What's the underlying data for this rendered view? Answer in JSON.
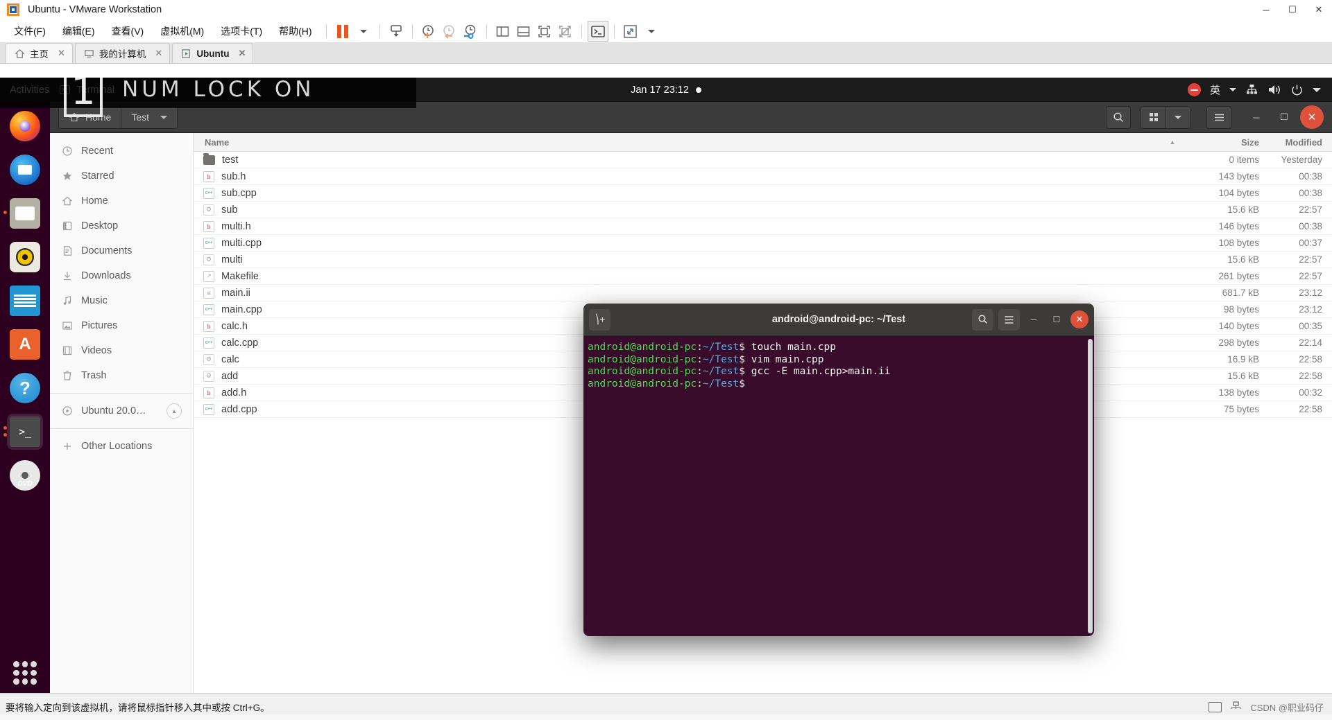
{
  "vmware": {
    "title": "Ubuntu - VMware Workstation",
    "logo_icon": "vmware-logo-icon",
    "window_controls": [
      {
        "name": "minimize-button",
        "glyph": "─"
      },
      {
        "name": "maximize-button",
        "glyph": "❐"
      },
      {
        "name": "close-button",
        "glyph": "✕"
      }
    ],
    "menus": [
      {
        "label": "文件(F)",
        "name": "menu-file"
      },
      {
        "label": "编辑(E)",
        "name": "menu-edit"
      },
      {
        "label": "查看(V)",
        "name": "menu-view"
      },
      {
        "label": "虚拟机(M)",
        "name": "menu-vm"
      },
      {
        "label": "选项卡(T)",
        "name": "menu-tabs"
      },
      {
        "label": "帮助(H)",
        "name": "menu-help"
      }
    ],
    "toolbar": [
      {
        "name": "suspend-button",
        "icon": "pause-icon"
      },
      {
        "name": "power-dropdown",
        "icon": "chevron-down-icon"
      },
      {
        "name": "send-ctrl-alt-del-button",
        "icon": "keyboard-send-icon"
      },
      {
        "name": "take-snapshot-button",
        "icon": "snapshot-add-icon"
      },
      {
        "name": "revert-snapshot-button",
        "icon": "snapshot-revert-icon"
      },
      {
        "name": "snapshot-manager-button",
        "icon": "snapshot-manage-icon"
      },
      {
        "name": "show-library-button",
        "icon": "panel-left-icon"
      },
      {
        "name": "show-thumbnail-bar-button",
        "icon": "panel-bottom-icon"
      },
      {
        "name": "show-console-view-button",
        "icon": "console-view-icon"
      },
      {
        "name": "hide-console-view-button",
        "icon": "console-view-off-icon"
      },
      {
        "name": "unity-mode-button",
        "icon": "terminal-prompt-icon"
      },
      {
        "name": "fullscreen-button",
        "icon": "expand-arrows-icon"
      },
      {
        "name": "fullscreen-dropdown",
        "icon": "chevron-down-icon"
      }
    ],
    "tabs": [
      {
        "label": "主页",
        "icon": "home-icon",
        "name": "tab-home",
        "active": false
      },
      {
        "label": "我的计算机",
        "icon": "computer-icon",
        "name": "tab-my-computer",
        "active": false
      },
      {
        "label": "Ubuntu",
        "icon": "vm-play-icon",
        "name": "tab-ubuntu",
        "active": true
      }
    ],
    "tab_close_glyph": "✕",
    "statusbar": {
      "hint": "要将输入定向到该虚拟机，请将鼠标指针移入其中或按 Ctrl+G。",
      "watermark": "CSDN @职业码仔",
      "icons": [
        "hdd-activity-icon",
        "network-activity-icon"
      ]
    }
  },
  "numlock_overlay": {
    "badge": "1",
    "text": "NUM LOCK ON"
  },
  "gnome": {
    "topbar": {
      "activities": "Activities",
      "app_name": "Terminal",
      "app_icon": "terminal-icon",
      "clock": "Jan 17  23:12",
      "notification_dot": "notification-dot-icon",
      "ime": "英",
      "indicators": [
        "do-not-disturb-icon",
        "ime-switcher",
        "network-icon",
        "volume-icon",
        "power-icon",
        "chevron-down-icon"
      ]
    },
    "dock": [
      {
        "name": "dock-firefox",
        "label": "Firefox",
        "icon": "firefox-icon",
        "running": false
      },
      {
        "name": "dock-thunderbird",
        "label": "Thunderbird",
        "icon": "thunderbird-icon",
        "running": false
      },
      {
        "name": "dock-files",
        "label": "Files",
        "icon": "files-icon",
        "running": true
      },
      {
        "name": "dock-rhythmbox",
        "label": "Rhythmbox",
        "icon": "rhythmbox-icon",
        "running": false
      },
      {
        "name": "dock-libreoffice",
        "label": "LibreOffice Writer",
        "icon": "libreoffice-writer-icon",
        "running": false
      },
      {
        "name": "dock-software",
        "label": "Ubuntu Software",
        "icon": "ubuntu-software-icon",
        "running": false
      },
      {
        "name": "dock-help",
        "label": "Help",
        "icon": "help-icon",
        "running": false
      },
      {
        "name": "dock-terminal",
        "label": "Terminal",
        "icon": "terminal-icon",
        "running": true
      },
      {
        "name": "dock-dvd",
        "label": "Ubuntu 20.0...",
        "icon": "dvd-disc-icon",
        "running": false
      }
    ],
    "show_apps": "show-applications-icon"
  },
  "files_app": {
    "breadcrumbs": [
      {
        "label": "Home",
        "icon": "home-icon",
        "name": "breadcrumb-home"
      },
      {
        "label": "Test",
        "icon": "chevron-down-icon",
        "name": "breadcrumb-test"
      }
    ],
    "header_buttons": [
      {
        "name": "search-button",
        "icon": "search-icon"
      },
      {
        "name": "grid-view-button",
        "icon": "grid-view-icon"
      },
      {
        "name": "view-options-dropdown",
        "icon": "chevron-down-icon"
      },
      {
        "name": "hamburger-menu-button",
        "icon": "hamburger-menu-icon"
      },
      {
        "name": "window-minimize-button",
        "icon": "minimize-icon"
      },
      {
        "name": "window-maximize-button",
        "icon": "maximize-icon"
      },
      {
        "name": "window-close-button",
        "icon": "close-icon"
      }
    ],
    "sidebar": [
      {
        "label": "Recent",
        "icon": "clock-icon",
        "name": "sidebar-item-recent"
      },
      {
        "label": "Starred",
        "icon": "star-icon",
        "name": "sidebar-item-starred"
      },
      {
        "label": "Home",
        "icon": "home-icon",
        "name": "sidebar-item-home"
      },
      {
        "label": "Desktop",
        "icon": "desktop-icon",
        "name": "sidebar-item-desktop"
      },
      {
        "label": "Documents",
        "icon": "documents-icon",
        "name": "sidebar-item-documents"
      },
      {
        "label": "Downloads",
        "icon": "download-icon",
        "name": "sidebar-item-downloads"
      },
      {
        "label": "Music",
        "icon": "music-note-icon",
        "name": "sidebar-item-music"
      },
      {
        "label": "Pictures",
        "icon": "picture-icon",
        "name": "sidebar-item-pictures"
      },
      {
        "label": "Videos",
        "icon": "film-icon",
        "name": "sidebar-item-videos"
      },
      {
        "label": "Trash",
        "icon": "trash-icon",
        "name": "sidebar-item-trash"
      }
    ],
    "sidebar_volume": {
      "label": "Ubuntu 20.0…",
      "icon": "disc-icon",
      "eject_icon": "eject-icon",
      "name": "sidebar-item-ubuntu-volume"
    },
    "sidebar_other": {
      "label": "Other Locations",
      "icon": "plus-icon",
      "name": "sidebar-item-other-locations"
    },
    "columns": {
      "name": "Name",
      "size": "Size",
      "modified": "Modified",
      "sort_icon": "sort-ascending-icon"
    },
    "rows": [
      {
        "name": "test",
        "kind": "folder",
        "size": "0 items",
        "modified": "Yesterday"
      },
      {
        "name": "sub.h",
        "kind": "h",
        "size": "143 bytes",
        "modified": "00:38"
      },
      {
        "name": "sub.cpp",
        "kind": "cpp",
        "size": "104 bytes",
        "modified": "00:38"
      },
      {
        "name": "sub",
        "kind": "exe",
        "size": "15.6 kB",
        "modified": "22:57"
      },
      {
        "name": "multi.h",
        "kind": "h",
        "size": "146 bytes",
        "modified": "00:38"
      },
      {
        "name": "multi.cpp",
        "kind": "cpp",
        "size": "108 bytes",
        "modified": "00:37"
      },
      {
        "name": "multi",
        "kind": "exe",
        "size": "15.6 kB",
        "modified": "22:57"
      },
      {
        "name": "Makefile",
        "kind": "mk",
        "size": "261 bytes",
        "modified": "22:57"
      },
      {
        "name": "main.ii",
        "kind": "txt",
        "size": "681.7 kB",
        "modified": "23:12"
      },
      {
        "name": "main.cpp",
        "kind": "cpp",
        "size": "98 bytes",
        "modified": "23:12"
      },
      {
        "name": "calc.h",
        "kind": "h",
        "size": "140 bytes",
        "modified": "00:35"
      },
      {
        "name": "calc.cpp",
        "kind": "cpp",
        "size": "298 bytes",
        "modified": "22:14"
      },
      {
        "name": "calc",
        "kind": "exe",
        "size": "16.9 kB",
        "modified": "22:58"
      },
      {
        "name": "add",
        "kind": "exe",
        "size": "15.6 kB",
        "modified": "22:58"
      },
      {
        "name": "add.h",
        "kind": "h",
        "size": "138 bytes",
        "modified": "00:32"
      },
      {
        "name": "add.cpp",
        "kind": "cpp",
        "size": "75 bytes",
        "modified": "22:58"
      }
    ]
  },
  "terminal": {
    "title": "android@android-pc: ~/Test",
    "new_tab_icon": "new-tab-icon",
    "buttons": [
      {
        "name": "terminal-search-button",
        "icon": "search-icon"
      },
      {
        "name": "terminal-menu-button",
        "icon": "hamburger-menu-icon"
      },
      {
        "name": "terminal-minimize-button",
        "icon": "minimize-icon"
      },
      {
        "name": "terminal-maximize-button",
        "icon": "maximize-icon"
      },
      {
        "name": "terminal-close-button",
        "icon": "close-icon"
      }
    ],
    "prompt": {
      "user": "android@android-pc",
      "colon": ":",
      "path": "~/Test",
      "dollar": "$"
    },
    "lines": [
      {
        "command": "touch main.cpp"
      },
      {
        "command": "vim main.cpp"
      },
      {
        "command": "gcc -E main.cpp>main.ii"
      },
      {
        "command": ""
      }
    ],
    "annotation_arrow": {
      "name": "red-arrow-annotation",
      "color": "#ee1c25"
    }
  },
  "colors": {
    "ubuntu_purple": "#2c001e",
    "terminal_bg": "#380c2a",
    "accent_orange": "#e95420",
    "prompt_green": "#4ade50",
    "prompt_blue": "#5ba7d8",
    "close_red": "#e0513b"
  }
}
